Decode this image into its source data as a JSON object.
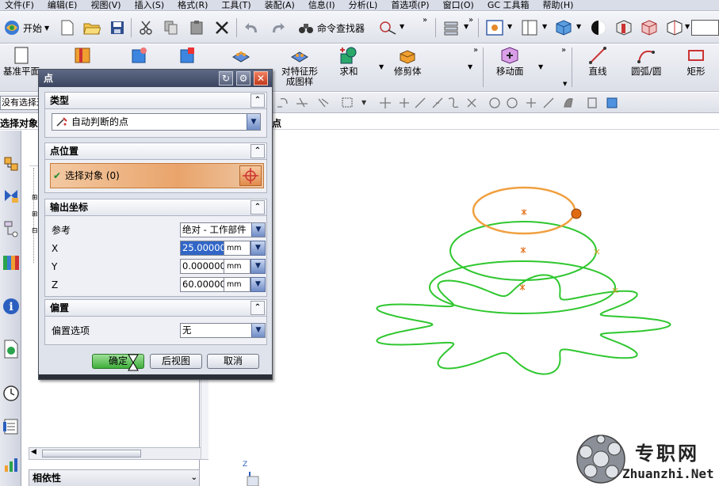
{
  "menubar": {
    "items": [
      "文件(F)",
      "编辑(E)",
      "视图(V)",
      "插入(S)",
      "格式(R)",
      "工具(T)",
      "装配(A)",
      "信息(I)",
      "分析(L)",
      "首选项(P)",
      "窗口(O)",
      "GC 工具箱",
      "帮助(H)"
    ]
  },
  "toolbar": {
    "start_label": "开始",
    "command_finder_label": "命令查找器"
  },
  "feature_toolbar": {
    "datum_label": "基准平面",
    "offset_region_label_1": "对特征形",
    "offset_region_label_2": "成图样",
    "unite_label": "求和",
    "trim_body_label": "修剪体",
    "move_face_label": "移动面",
    "line_label": "直线",
    "arc_label": "圆弧/圆",
    "rect_label": "矩形"
  },
  "selection_bar": {
    "filter_value": "没有选择过滤器"
  },
  "cue": {
    "left": "选择对象",
    "right": "点"
  },
  "navigator": {
    "dependency_label": "相依性"
  },
  "dialog": {
    "title": "点",
    "type_group": {
      "label": "类型",
      "selected": "自动判断的点"
    },
    "point_location_group": {
      "label": "点位置",
      "select_object": "选择对象 (0)"
    },
    "output_coords_group": {
      "label": "输出坐标",
      "reference_label": "参考",
      "reference_value": "绝对 - 工作部件",
      "x_label": "X",
      "x_value": "25.000000",
      "y_label": "Y",
      "y_value": "0.0000000",
      "z_label": "Z",
      "z_value": "60.000000",
      "unit": "mm"
    },
    "offset_group": {
      "label": "偏置",
      "option_label": "偏置选项",
      "option_value": "无"
    },
    "buttons": {
      "ok": "确定",
      "back": "后视图",
      "cancel": "取消"
    }
  },
  "graphics": {
    "triad_label": "Z"
  },
  "watermark": {
    "brand_cn": "专职网",
    "brand_url": "Zhuanzhi.Net"
  },
  "colors": {
    "curve_green": "#2fc72f",
    "curve_highlight": "#f0a040",
    "dialog_title": "#3b4560",
    "select_bar": "#e9a46b"
  }
}
